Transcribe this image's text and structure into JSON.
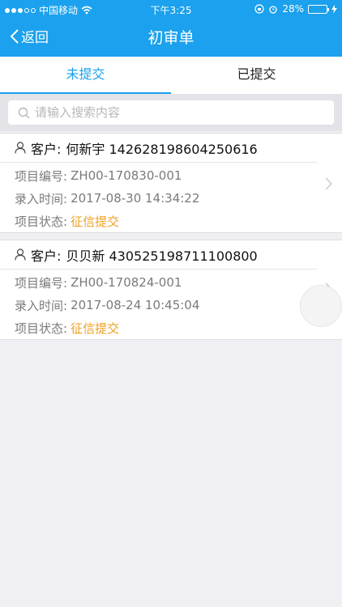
{
  "status_bar": {
    "carrier": "中国移动",
    "time": "下午3:25",
    "battery": "28%",
    "battery_level": 0.28
  },
  "nav": {
    "back_label": "返回",
    "title": "初审单"
  },
  "tabs": [
    {
      "label": "未提交",
      "active": true
    },
    {
      "label": "已提交",
      "active": false
    }
  ],
  "search": {
    "placeholder": "请输入搜索内容",
    "value": ""
  },
  "records": [
    {
      "customer_label": "客户:",
      "customer": "何新宇 142628198604250616",
      "fields": [
        {
          "label": "项目编号:",
          "value": "ZH00-170830-001"
        },
        {
          "label": "录入时间:",
          "value": "2017-08-30 14:34:22"
        },
        {
          "label": "项目状态:",
          "value": "征信提交"
        }
      ]
    },
    {
      "customer_label": "客户:",
      "customer": "贝贝新 430525198711100800",
      "fields": [
        {
          "label": "项目编号:",
          "value": "ZH00-170824-001"
        },
        {
          "label": "录入时间:",
          "value": "2017-08-24 10:45:04"
        },
        {
          "label": "项目状态:",
          "value": "征信提交"
        }
      ]
    }
  ],
  "colors": {
    "accent": "#1ba1ed",
    "status": "#f0a020",
    "background": "#efeff4"
  }
}
